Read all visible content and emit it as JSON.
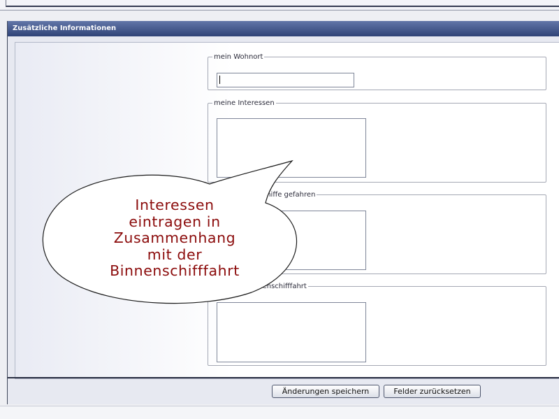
{
  "panel": {
    "title": "Zusätzliche Informationen"
  },
  "fields": {
    "wohnort": {
      "legend": "mein Wohnort",
      "value": ""
    },
    "interessen": {
      "legend": "meine Interessen",
      "value": ""
    },
    "binnenschiffe": {
      "legend": "enschiffe gefahren",
      "value": ""
    },
    "binnenschifffahrt": {
      "legend": "r Binnenschifffahrt",
      "value": ""
    }
  },
  "buttons": {
    "save_label": "Änderungen speichern",
    "reset_label": "Felder zurücksetzen"
  },
  "callout": {
    "lines": [
      "Interessen",
      "eintragen in",
      "Zusammenhang",
      "mit der",
      "Binnenschifffahrt"
    ],
    "color": "#8b0b0b"
  }
}
